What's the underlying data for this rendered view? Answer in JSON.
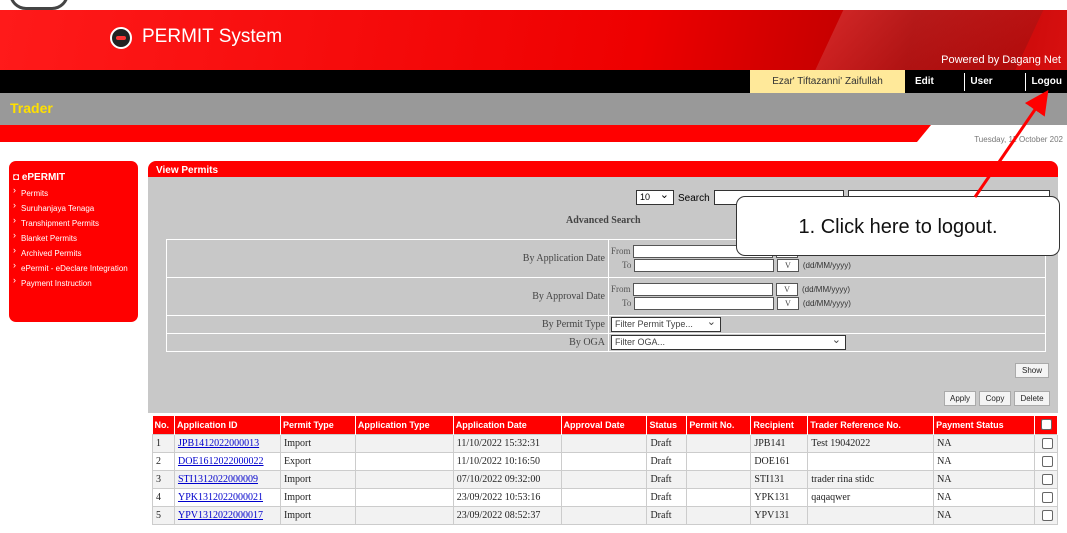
{
  "app": {
    "title": "PERMIT System",
    "powered_by": "Powered by Dagang Net"
  },
  "user": {
    "name": "Ezar' Tiftazanni' Zaifullah"
  },
  "top_menu": [
    "Edit Profile",
    "User Manual",
    "Logou"
  ],
  "role": "Trader",
  "date": "Tuesday, 11 October 202",
  "sidebar": {
    "title": "ePERMIT",
    "items": [
      "Permits",
      "Suruhanjaya Tenaga",
      "Transhipment Permits",
      "Blanket Permits",
      "Archived Permits",
      "ePermit - eDeclare Integration",
      "Payment Instruction"
    ]
  },
  "view_permits": {
    "title": "View Permits",
    "page_size": "10",
    "search_label": "Search",
    "search_value": "",
    "search_filter": "",
    "advanced_search": "Advanced Search",
    "by_application_date": "By Application Date",
    "by_approval_date": "By Approval Date",
    "from": "From",
    "to": "To",
    "v": "V",
    "date_format": "(dd/MM/yyyy)",
    "by_permit_type": "By Permit Type",
    "permit_type_placeholder": "Filter Permit Type...",
    "by_oga": "By OGA",
    "oga_placeholder": "Filter OGA...",
    "show": "Show",
    "apply": "Apply",
    "copy": "Copy",
    "delete": "Delete"
  },
  "table": {
    "headers": [
      "No.",
      "Application ID",
      "Permit Type",
      "Application Type",
      "Application Date",
      "Approval Date",
      "Status",
      "Permit No.",
      "Recipient",
      "Trader Reference No.",
      "Payment Status"
    ],
    "rows": [
      [
        "1",
        "JPB1412022000013",
        "Import",
        "",
        "11/10/2022 15:32:31",
        "",
        "Draft",
        "",
        "JPB141",
        "Test 19042022",
        "NA"
      ],
      [
        "2",
        "DOE1612022000022",
        "Export",
        "",
        "11/10/2022 10:16:50",
        "",
        "Draft",
        "",
        "DOE161",
        "",
        "NA"
      ],
      [
        "3",
        "STI1312022000009",
        "Import",
        "",
        "07/10/2022 09:32:00",
        "",
        "Draft",
        "",
        "STI131",
        "trader rina stidc",
        "NA"
      ],
      [
        "4",
        "YPK1312022000021",
        "Import",
        "",
        "23/09/2022 10:53:16",
        "",
        "Draft",
        "",
        "YPK131",
        "qaqaqwer",
        "NA"
      ],
      [
        "5",
        "YPV1312022000017",
        "Import",
        "",
        "23/09/2022 08:52:37",
        "",
        "Draft",
        "",
        "YPV131",
        "",
        "NA"
      ]
    ]
  },
  "callout": {
    "text": "1.  Click here to logout."
  },
  "colors": {
    "primary_red": "#ff0000",
    "trader_yellow": "#ffe000",
    "user_bg": "#ffe99a"
  }
}
